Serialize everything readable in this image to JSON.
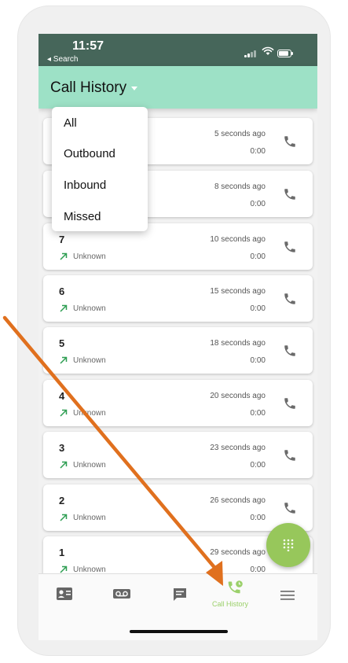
{
  "status_bar": {
    "time": "11:57",
    "back_label": "◂ Search"
  },
  "header": {
    "title": "Call History"
  },
  "filter_menu": {
    "items": [
      "All",
      "Outbound",
      "Inbound",
      "Missed"
    ]
  },
  "calls": [
    {
      "number": "",
      "name": "",
      "time": "5 seconds ago",
      "duration": "0:00"
    },
    {
      "number": "",
      "name": "",
      "time": "8 seconds ago",
      "duration": "0:00"
    },
    {
      "number": "7",
      "name": "Unknown",
      "time": "10 seconds ago",
      "duration": "0:00"
    },
    {
      "number": "6",
      "name": "Unknown",
      "time": "15 seconds ago",
      "duration": "0:00"
    },
    {
      "number": "5",
      "name": "Unknown",
      "time": "18 seconds ago",
      "duration": "0:00"
    },
    {
      "number": "4",
      "name": "Unknown",
      "time": "20 seconds ago",
      "duration": "0:00"
    },
    {
      "number": "3",
      "name": "Unknown",
      "time": "23 seconds ago",
      "duration": "0:00"
    },
    {
      "number": "2",
      "name": "Unknown",
      "time": "26 seconds ago",
      "duration": "0:00"
    },
    {
      "number": "1",
      "name": "Unknown",
      "time": "29 seconds ago",
      "duration": "0:00"
    }
  ],
  "bottom_nav": {
    "active_label": "Call History",
    "icons": [
      "contacts-icon",
      "voicemail-icon",
      "messages-icon",
      "call-history-icon",
      "menu-icon"
    ]
  },
  "colors": {
    "status_bar": "#46665a",
    "header": "#9de1c6",
    "accent_green": "#97c75b",
    "annotation_arrow": "#e0701e"
  }
}
